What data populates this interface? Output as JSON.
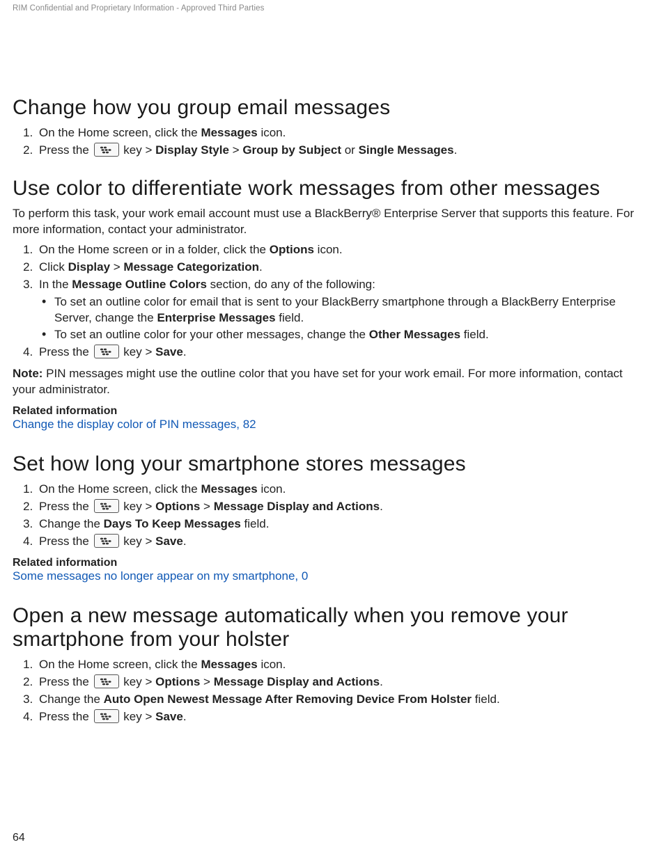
{
  "header": {
    "confidential": "RIM Confidential and Proprietary Information - Approved Third Parties"
  },
  "page_number": "64",
  "icons": {
    "bbkey": "blackberry-menu-key-icon"
  },
  "sections": [
    {
      "id": "group-email",
      "title": "Change how you group email messages",
      "steps": [
        {
          "num": "1.",
          "frags": [
            {
              "t": "text",
              "v": "On the Home screen, click the "
            },
            {
              "t": "b",
              "v": "Messages"
            },
            {
              "t": "text",
              "v": " icon."
            }
          ]
        },
        {
          "num": "2.",
          "frags": [
            {
              "t": "text",
              "v": "Press the "
            },
            {
              "t": "bbkey"
            },
            {
              "t": "text",
              "v": " key > "
            },
            {
              "t": "b",
              "v": "Display Style"
            },
            {
              "t": "text",
              "v": " > "
            },
            {
              "t": "b",
              "v": "Group by Subject"
            },
            {
              "t": "text",
              "v": " or "
            },
            {
              "t": "b",
              "v": "Single Messages"
            },
            {
              "t": "text",
              "v": "."
            }
          ]
        }
      ]
    },
    {
      "id": "color-diff",
      "title": "Use color to differentiate work messages from other messages",
      "intro": [
        {
          "t": "text",
          "v": "To perform this task, your work email account must use a BlackBerry® Enterprise Server that supports this feature. For more information, contact your administrator."
        }
      ],
      "steps": [
        {
          "num": "1.",
          "frags": [
            {
              "t": "text",
              "v": "On the Home screen or in a folder, click the "
            },
            {
              "t": "b",
              "v": "Options"
            },
            {
              "t": "text",
              "v": " icon."
            }
          ]
        },
        {
          "num": "2.",
          "frags": [
            {
              "t": "text",
              "v": "Click "
            },
            {
              "t": "b",
              "v": "Display"
            },
            {
              "t": "text",
              "v": " > "
            },
            {
              "t": "b",
              "v": "Message Categorization"
            },
            {
              "t": "text",
              "v": "."
            }
          ]
        },
        {
          "num": "3.",
          "frags": [
            {
              "t": "text",
              "v": "In the "
            },
            {
              "t": "b",
              "v": "Message Outline Colors"
            },
            {
              "t": "text",
              "v": " section, do any of the following:"
            }
          ],
          "bullets": [
            [
              {
                "t": "text",
                "v": "To set an outline color for email that is sent to your BlackBerry smartphone through a BlackBerry Enterprise Server, change the "
              },
              {
                "t": "b",
                "v": "Enterprise Messages"
              },
              {
                "t": "text",
                "v": " field."
              }
            ],
            [
              {
                "t": "text",
                "v": "To set an outline color for your other messages, change the "
              },
              {
                "t": "b",
                "v": "Other Messages"
              },
              {
                "t": "text",
                "v": " field."
              }
            ]
          ]
        },
        {
          "num": "4.",
          "frags": [
            {
              "t": "text",
              "v": "Press the "
            },
            {
              "t": "bbkey"
            },
            {
              "t": "text",
              "v": " key > "
            },
            {
              "t": "b",
              "v": "Save"
            },
            {
              "t": "text",
              "v": "."
            }
          ]
        }
      ],
      "note": [
        {
          "t": "b",
          "v": "Note: "
        },
        {
          "t": "text",
          "v": "PIN messages might use the outline color that you have set for your work email. For more information, contact your administrator."
        }
      ],
      "related": {
        "title": "Related information",
        "links": [
          {
            "text": "Change the display color of PIN messages, 82"
          }
        ]
      }
    },
    {
      "id": "store-duration",
      "title": "Set how long your smartphone stores messages",
      "steps": [
        {
          "num": "1.",
          "frags": [
            {
              "t": "text",
              "v": "On the Home screen, click the "
            },
            {
              "t": "b",
              "v": "Messages"
            },
            {
              "t": "text",
              "v": " icon."
            }
          ]
        },
        {
          "num": "2.",
          "frags": [
            {
              "t": "text",
              "v": "Press the "
            },
            {
              "t": "bbkey"
            },
            {
              "t": "text",
              "v": " key > "
            },
            {
              "t": "b",
              "v": "Options"
            },
            {
              "t": "text",
              "v": " > "
            },
            {
              "t": "b",
              "v": "Message Display and Actions"
            },
            {
              "t": "text",
              "v": "."
            }
          ]
        },
        {
          "num": "3.",
          "frags": [
            {
              "t": "text",
              "v": "Change the "
            },
            {
              "t": "b",
              "v": "Days To Keep Messages"
            },
            {
              "t": "text",
              "v": " field."
            }
          ]
        },
        {
          "num": "4.",
          "frags": [
            {
              "t": "text",
              "v": "Press the "
            },
            {
              "t": "bbkey"
            },
            {
              "t": "text",
              "v": " key > "
            },
            {
              "t": "b",
              "v": "Save"
            },
            {
              "t": "text",
              "v": "."
            }
          ]
        }
      ],
      "related": {
        "title": "Related information",
        "links": [
          {
            "text": "Some messages no longer appear on my smartphone,  0"
          }
        ]
      }
    },
    {
      "id": "auto-open",
      "title": "Open a new message automatically when you remove your smartphone from your holster",
      "steps": [
        {
          "num": "1.",
          "frags": [
            {
              "t": "text",
              "v": "On the Home screen, click the "
            },
            {
              "t": "b",
              "v": "Messages"
            },
            {
              "t": "text",
              "v": " icon."
            }
          ]
        },
        {
          "num": "2.",
          "frags": [
            {
              "t": "text",
              "v": "Press the "
            },
            {
              "t": "bbkey"
            },
            {
              "t": "text",
              "v": " key > "
            },
            {
              "t": "b",
              "v": "Options"
            },
            {
              "t": "text",
              "v": " > "
            },
            {
              "t": "b",
              "v": "Message Display and Actions"
            },
            {
              "t": "text",
              "v": "."
            }
          ]
        },
        {
          "num": "3.",
          "frags": [
            {
              "t": "text",
              "v": "Change the "
            },
            {
              "t": "b",
              "v": "Auto Open Newest Message After Removing Device From Holster"
            },
            {
              "t": "text",
              "v": " field."
            }
          ]
        },
        {
          "num": "4.",
          "frags": [
            {
              "t": "text",
              "v": "Press the "
            },
            {
              "t": "bbkey"
            },
            {
              "t": "text",
              "v": " key > "
            },
            {
              "t": "b",
              "v": "Save"
            },
            {
              "t": "text",
              "v": "."
            }
          ]
        }
      ]
    }
  ]
}
